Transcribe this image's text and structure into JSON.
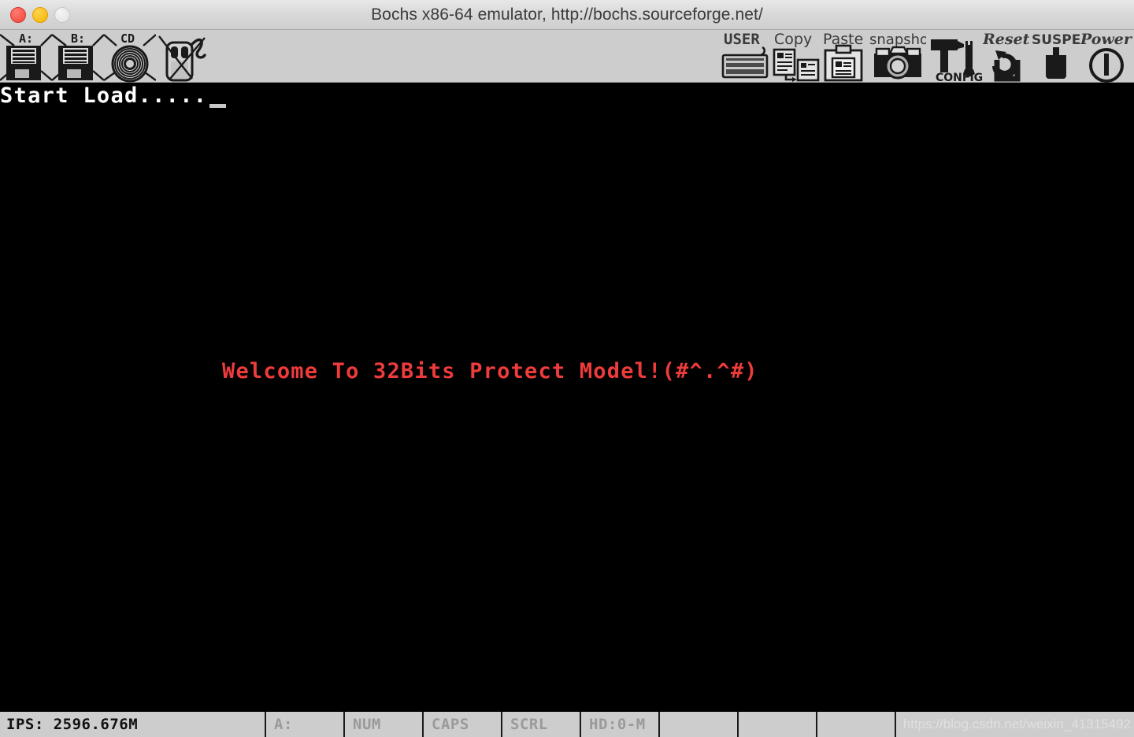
{
  "window": {
    "title": "Bochs x86-64 emulator, http://bochs.sourceforge.net/",
    "controls": {
      "close_label": "close",
      "minimize_label": "minimize",
      "maximize_label": "maximize"
    }
  },
  "toolbar": {
    "left_items": [
      {
        "label": "A:",
        "icon": "floppy-a-icon",
        "disabled": true
      },
      {
        "label": "B:",
        "icon": "floppy-b-icon",
        "disabled": true
      },
      {
        "label": "CD",
        "icon": "cdrom-icon",
        "disabled": true
      },
      {
        "label": "",
        "icon": "mouse-icon",
        "disabled": true
      }
    ],
    "right_items": [
      {
        "label": "USER",
        "icon": "keyboard-icon"
      },
      {
        "label": "Copy",
        "icon": "copy-icon"
      },
      {
        "label": "Paste",
        "icon": "paste-icon"
      },
      {
        "label": "snapshot",
        "icon": "camera-icon"
      },
      {
        "label": "CONFIG",
        "icon": "tools-icon"
      },
      {
        "label": "Reset",
        "icon": "reset-icon"
      },
      {
        "label": "SUSPEND",
        "icon": "suspend-icon"
      },
      {
        "label": "Power",
        "icon": "power-icon"
      }
    ]
  },
  "screen": {
    "boot_line": "Start Load.....",
    "welcome_line": "Welcome To 32Bits Protect Model!(#^.^#)",
    "welcome_color": "#ee3b3b",
    "boot_color": "#ffffff",
    "background": "#000000"
  },
  "statusbar": {
    "ips": "IPS: 2596.676M",
    "floppy": "A:",
    "num": "NUM",
    "caps": "CAPS",
    "scrl": "SCRL",
    "hd": "HD:0-M",
    "blank1": "",
    "blank2": "",
    "blank3": "",
    "watermark": "https://blog.csdn.net/weixin_41315492"
  }
}
